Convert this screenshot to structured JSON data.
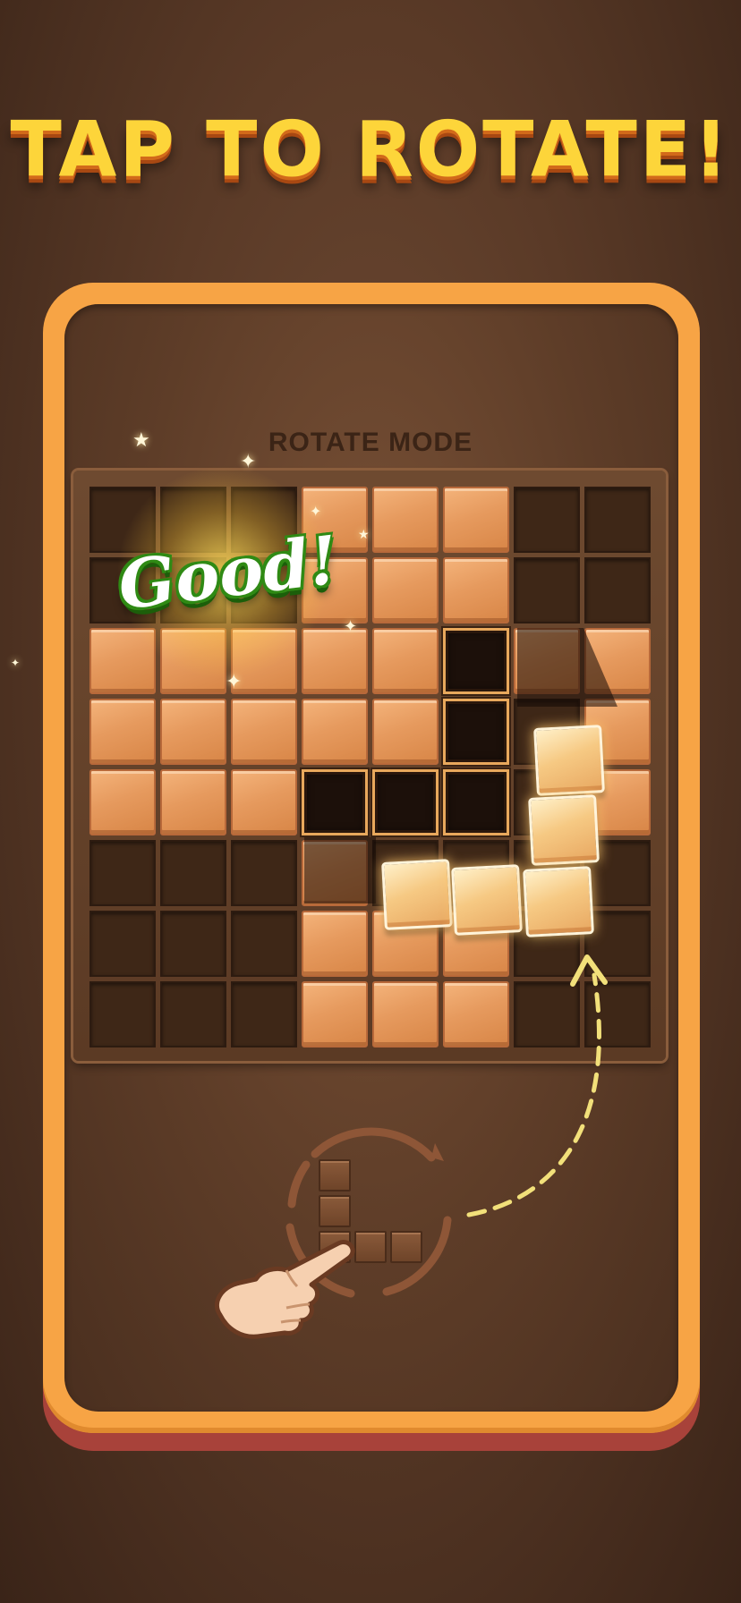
{
  "headline": "TAP TO ROTATE!",
  "mode_label": "ROTATE MODE",
  "feedback": "Good!",
  "board": {
    "size": 8,
    "rows": [
      [
        "empty",
        "empty",
        "empty",
        "wood",
        "wood",
        "wood",
        "empty",
        "empty"
      ],
      [
        "empty",
        "empty",
        "empty",
        "wood",
        "wood",
        "wood",
        "empty",
        "empty"
      ],
      [
        "wood",
        "wood",
        "wood",
        "wood",
        "wood",
        "target",
        "wood",
        "wood"
      ],
      [
        "wood",
        "wood",
        "wood",
        "wood",
        "wood",
        "target",
        "empty",
        "wood"
      ],
      [
        "wood",
        "wood",
        "wood",
        "target",
        "target",
        "target",
        "empty",
        "wood"
      ],
      [
        "empty",
        "empty",
        "empty",
        "wood",
        "empty",
        "empty",
        "empty",
        "empty"
      ],
      [
        "empty",
        "empty",
        "empty",
        "wood",
        "wood",
        "wood",
        "empty",
        "empty"
      ],
      [
        "empty",
        "empty",
        "empty",
        "wood",
        "wood",
        "wood",
        "empty",
        "empty"
      ]
    ]
  },
  "held_piece": {
    "shape": "L",
    "cells": 5
  },
  "tray_piece": {
    "shape": "L",
    "cells": 5
  },
  "icons": {
    "hand": "pointing-hand-icon",
    "rotate": "rotate-ring-icon",
    "arrow": "dashed-arrow-icon",
    "sparkle": "sparkle-icon"
  },
  "colors": {
    "headline": "#fdd53a",
    "frame": "#f7a445",
    "wood": "#e69a5e",
    "feedback": "#2f8a14"
  }
}
